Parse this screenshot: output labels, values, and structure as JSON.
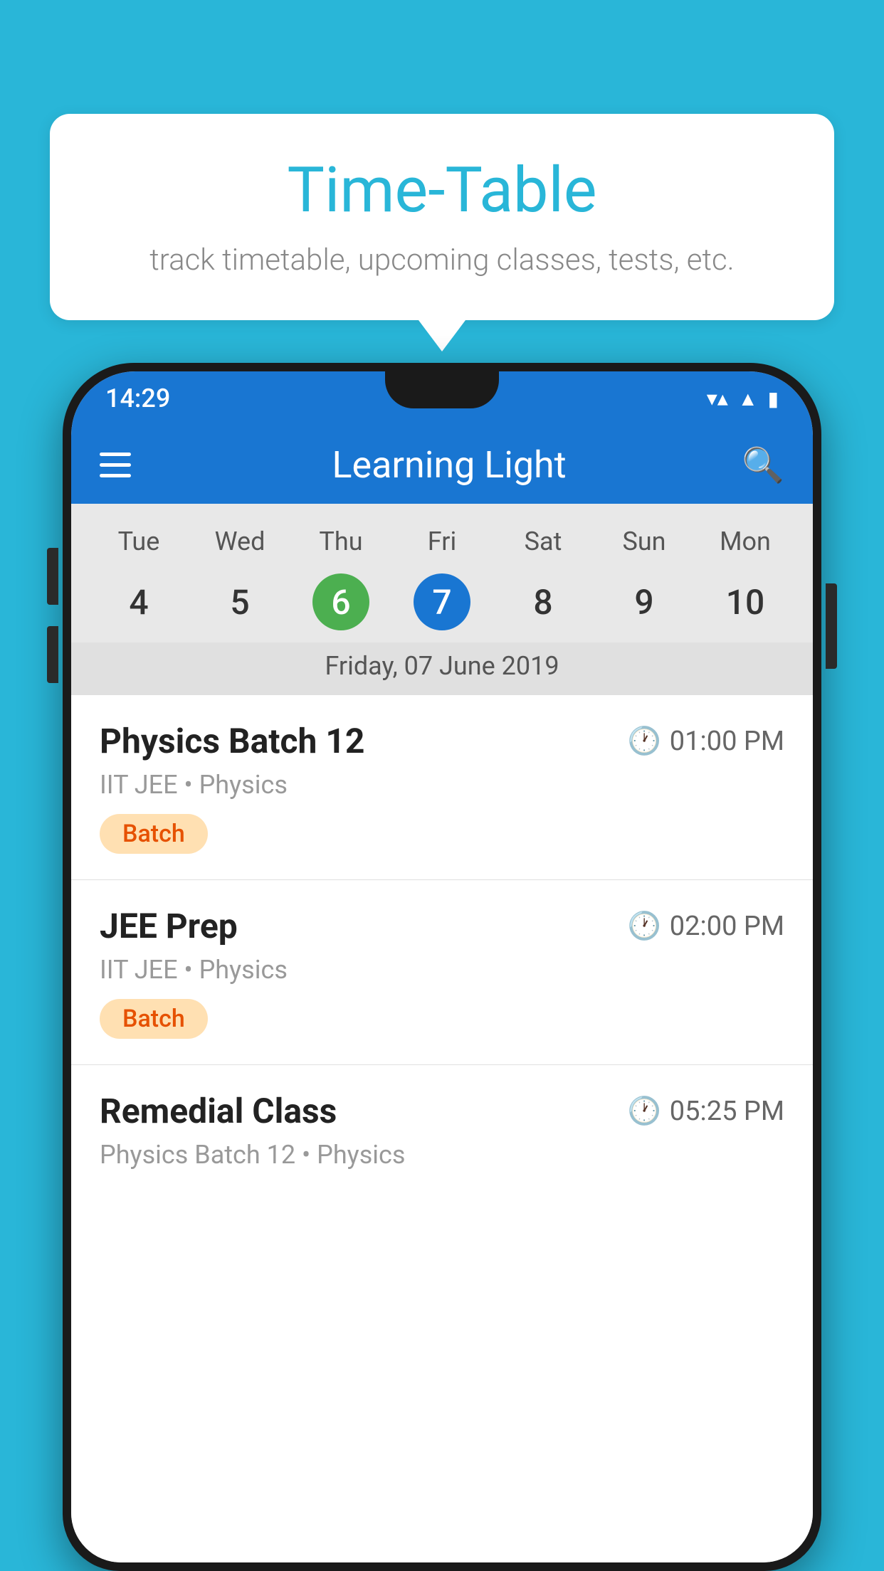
{
  "background_color": "#29B6D8",
  "bubble": {
    "title": "Time-Table",
    "subtitle": "track timetable, upcoming classes, tests, etc."
  },
  "phone": {
    "status_bar": {
      "time": "14:29"
    },
    "app_bar": {
      "title": "Learning Light"
    },
    "calendar": {
      "days": [
        "Tue",
        "Wed",
        "Thu",
        "Fri",
        "Sat",
        "Sun",
        "Mon"
      ],
      "dates": [
        "4",
        "5",
        "6",
        "7",
        "8",
        "9",
        "10"
      ],
      "today_index": 2,
      "selected_index": 3,
      "selected_label": "Friday, 07 June 2019"
    },
    "schedule": [
      {
        "title": "Physics Batch 12",
        "time": "01:00 PM",
        "meta": "IIT JEE • Physics",
        "badge": "Batch"
      },
      {
        "title": "JEE Prep",
        "time": "02:00 PM",
        "meta": "IIT JEE • Physics",
        "badge": "Batch"
      },
      {
        "title": "Remedial Class",
        "time": "05:25 PM",
        "meta": "Physics Batch 12 • Physics",
        "badge": ""
      }
    ]
  }
}
